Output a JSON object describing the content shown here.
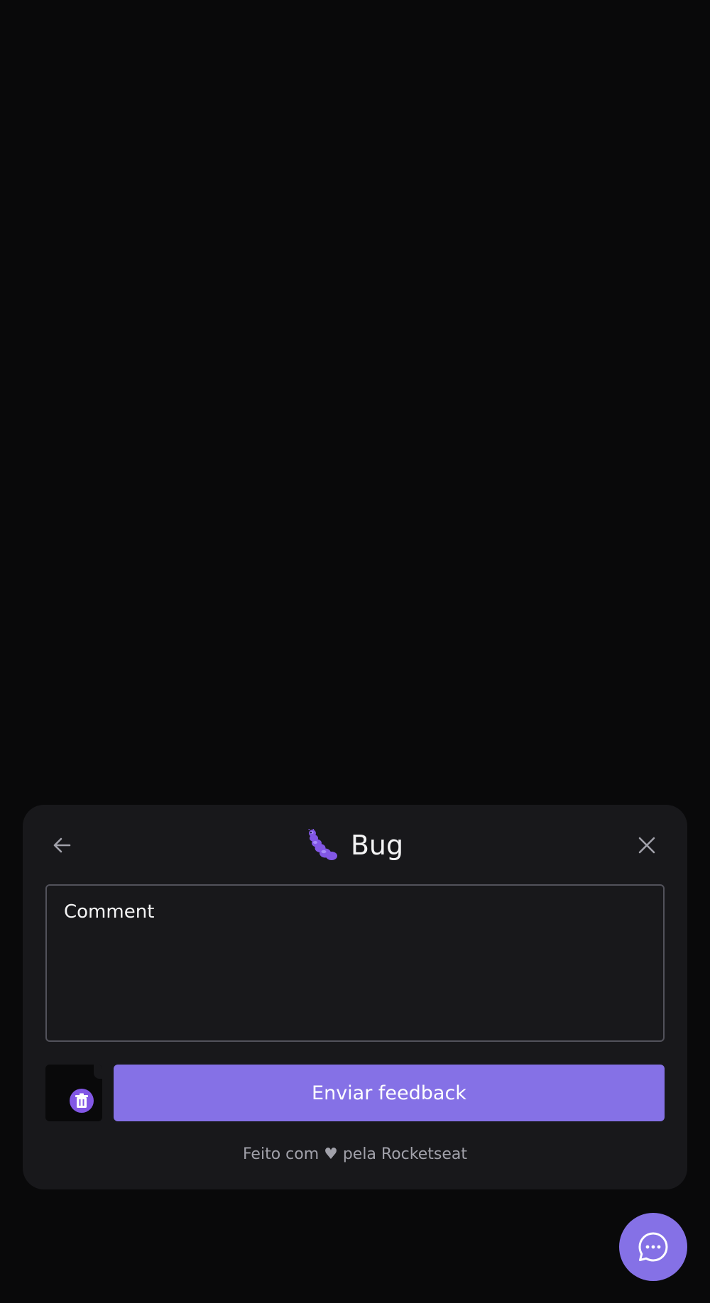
{
  "widget": {
    "title": "Bug",
    "title_icon": "bug-icon",
    "back_icon": "arrow-left-icon",
    "close_icon": "close-icon",
    "comment": {
      "placeholder": "Comment",
      "value": ""
    },
    "screenshot": {
      "remove_icon": "trash-icon"
    },
    "submit_label": "Enviar feedback",
    "footer": "Feito com ♥ pela Rocketseat"
  },
  "fab": {
    "icon": "chat-bubble-dots-icon"
  },
  "colors": {
    "background": "#09090a",
    "panel": "#18181b",
    "accent": "#8571e6",
    "border": "#52525b",
    "text": "#f4f4f5",
    "muted": "#a1a1aa"
  }
}
